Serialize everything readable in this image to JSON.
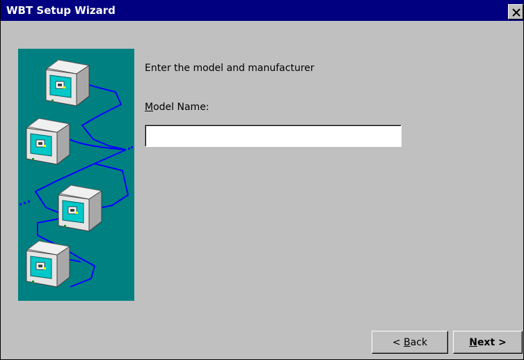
{
  "window": {
    "title": "WBT Setup Wizard",
    "close_glyph": "×"
  },
  "content": {
    "prompt": "Enter the model and manufacturer",
    "model_label_mnemonic": "M",
    "model_label_rest": "odel Name:",
    "model_value": ""
  },
  "buttons": {
    "back_prefix": "< ",
    "back_mnemonic": "B",
    "back_rest": "ack",
    "next_mnemonic": "N",
    "next_rest": "ext >"
  },
  "icons": {
    "close": "close-icon",
    "illustration": "networked-computers-illustration"
  },
  "colors": {
    "titlebar": "#000080",
    "illustration_bg": "#008080",
    "network_line": "#0000ff",
    "window_face": "#c0c0c0"
  }
}
